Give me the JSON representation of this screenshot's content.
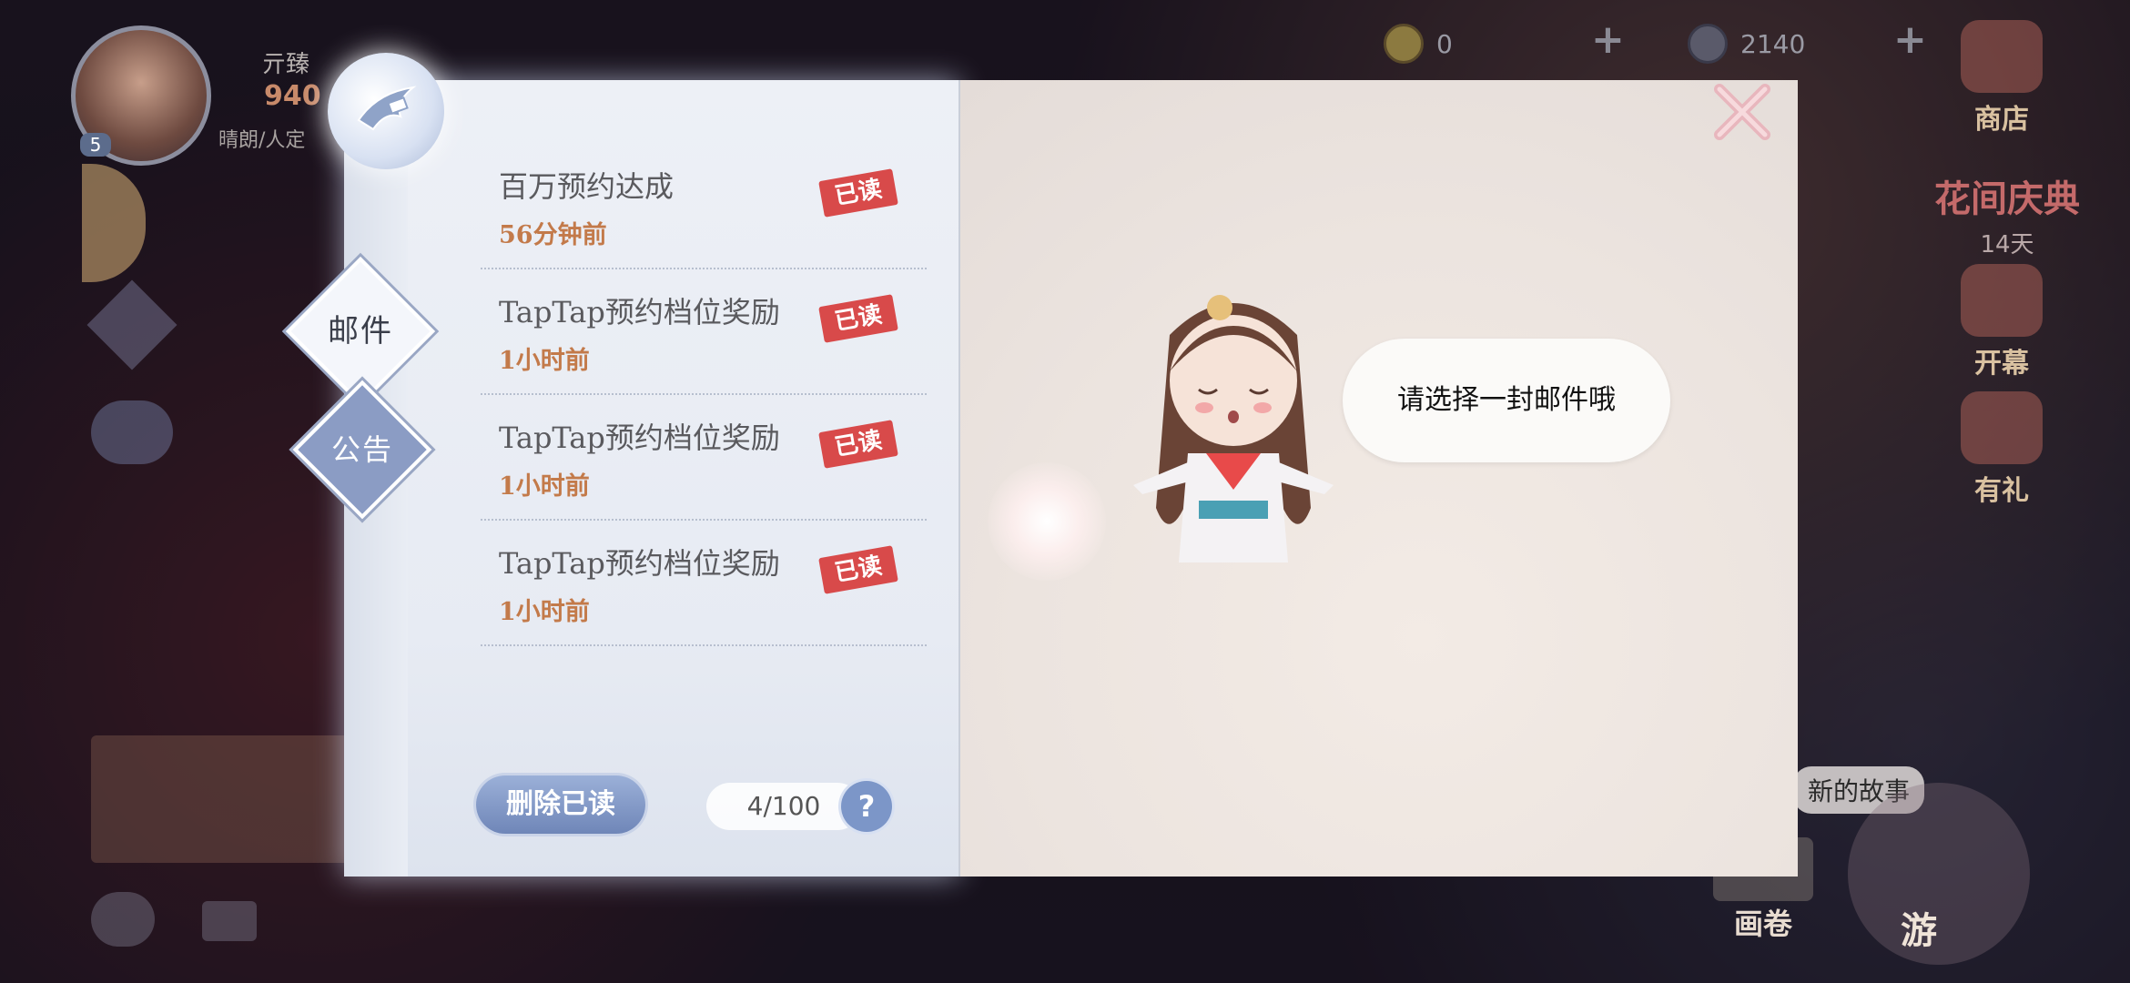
{
  "hud": {
    "player_name": "亓臻",
    "player_level": "5",
    "player_value": "940",
    "player_status": "晴朗/人定",
    "currency1": "0",
    "currency2": "2140"
  },
  "right_menu": {
    "shop": "商店",
    "event": "花间庆典",
    "event_days": "14天",
    "open": "开幕",
    "gift": "有礼"
  },
  "bottom": {
    "scroll": "画卷",
    "travel": "游",
    "story": "新的故事"
  },
  "tabs": {
    "mail": "邮件",
    "notice": "公告"
  },
  "mails": [
    {
      "title": "百万预约达成",
      "time": "56分钟前",
      "status": "已读"
    },
    {
      "title": "TapTap预约档位奖励",
      "time": "1小时前",
      "status": "已读"
    },
    {
      "title": "TapTap预约档位奖励",
      "time": "1小时前",
      "status": "已读"
    },
    {
      "title": "TapTap预约档位奖励",
      "time": "1小时前",
      "status": "已读"
    }
  ],
  "footer": {
    "delete_read": "删除已读",
    "count": "4/100",
    "help": "?"
  },
  "speech_bubble": "请选择一封邮件哦",
  "colors": {
    "stamp": "#d84a4a",
    "time": "#c37a4a",
    "tab_active": "#8b9cc4",
    "button": "#6f86b8"
  }
}
